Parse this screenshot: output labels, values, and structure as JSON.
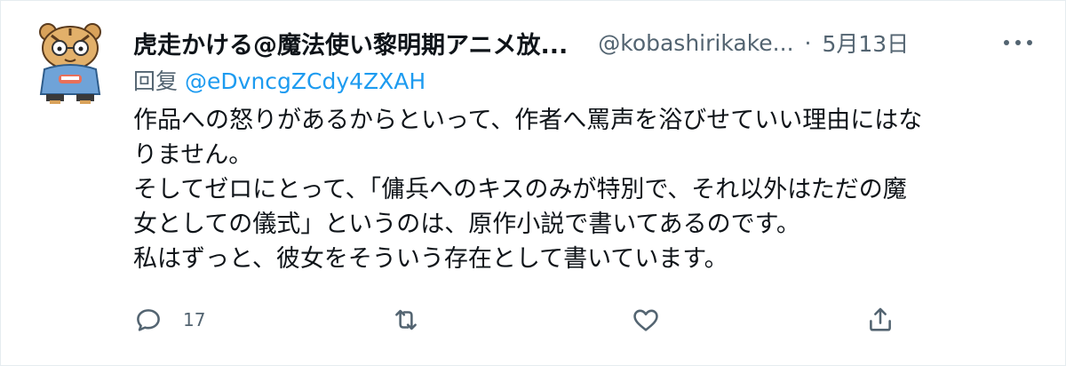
{
  "tweet": {
    "display_name": "虎走かける@魔法使い黎明期アニメ放...",
    "handle": "@kobashirikake...",
    "separator": "·",
    "date": "5月13日",
    "reply_prefix": "回复",
    "reply_to": "@eDvncgZCdy4ZXAH",
    "text_lines": [
      "作品への怒りがあるからといって、作者へ罵声を浴びせていい理由にはな",
      "りません。",
      "そしてゼロにとって、「傭兵へのキスのみが特別で、それ以外はただの魔",
      "女としての儀式」というのは、原作小説で書いてあるのです。",
      "私はずっと、彼女をそういう存在として書いています。"
    ]
  },
  "actions": {
    "reply_icon": "reply-icon",
    "reply_count": "17",
    "retweet_icon": "retweet-icon",
    "like_icon": "heart-icon",
    "share_icon": "share-icon"
  },
  "colors": {
    "text": "#0f1419",
    "secondary": "#536471",
    "link": "#1d9bf0",
    "border": "#e6ecf0"
  }
}
